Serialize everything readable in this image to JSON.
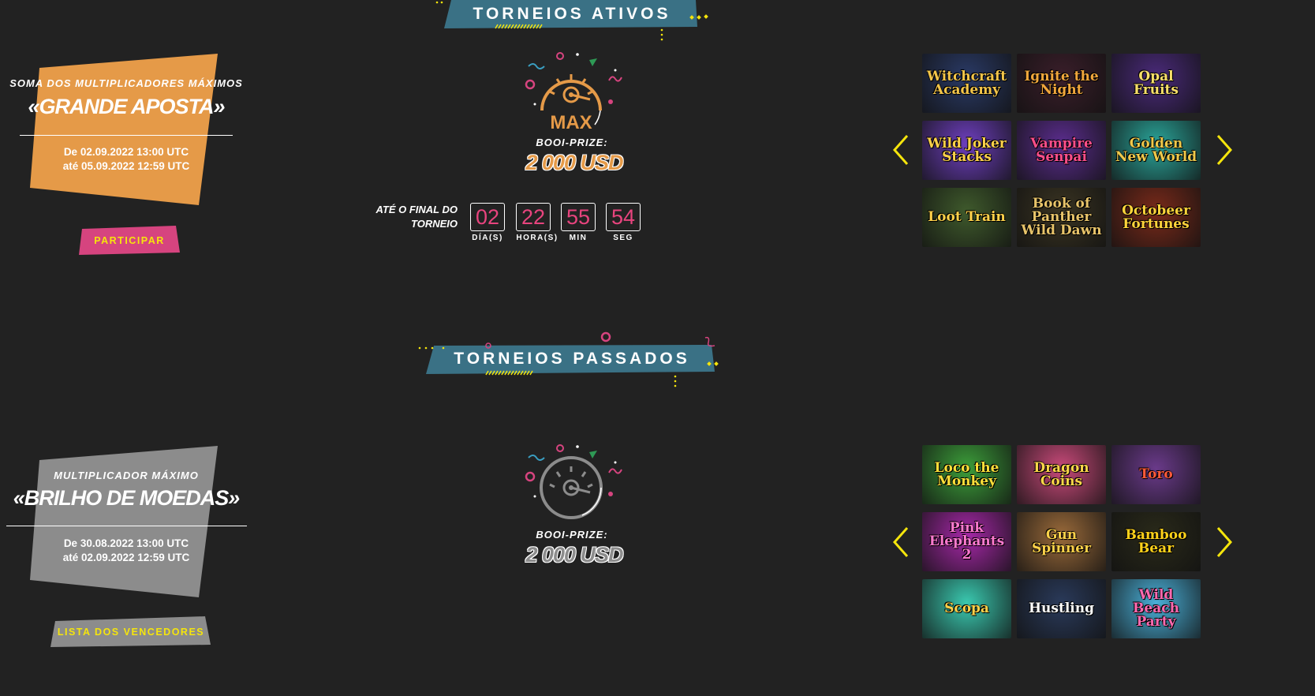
{
  "colors": {
    "background": "#222222",
    "banner": "#3a7185",
    "accent_yellow": "#f5e50c",
    "accent_pink": "#d6447f",
    "active_card": "#e59a48",
    "past_card": "#8c8c8c",
    "countdown_digits": "#e8447e",
    "arrow": "#f5e50c"
  },
  "active": {
    "heading": "TORNEIOS ATIVOS",
    "card": {
      "label": "SOMA DOS MULTIPLICADORES MÁXIMOS",
      "title": "«GRANDE APOSTA»",
      "dates_from": "De 02.09.2022 13:00 UTC",
      "dates_to": "até 05.09.2022 12:59 UTC",
      "button": "PARTICIPAR"
    },
    "gauge_text": "MAX",
    "prize_label": "BOOI-PRIZE:",
    "prize_value": "2 000 USD",
    "countdown": {
      "caption_line1": "ATÉ O FINAL DO",
      "caption_line2": "TORNEIO",
      "days": "02",
      "hours": "22",
      "minutes": "55",
      "seconds": "54",
      "days_label": "DÍA(S)",
      "hours_label": "HORA(S)",
      "minutes_label": "MIN",
      "seconds_label": "SEG"
    },
    "games": [
      {
        "name": "Witchcraft Academy",
        "bg": "#2a3a66",
        "fg": "#f4c64a",
        "icon": "witch-dragon"
      },
      {
        "name": "Ignite the Night",
        "bg": "#3a1e2a",
        "fg": "#f1a73c",
        "icon": "torch-dancer"
      },
      {
        "name": "Opal Fruits",
        "bg": "#4a2a7a",
        "fg": "#fbe06a",
        "icon": "fruits"
      },
      {
        "name": "Wild Joker Stacks",
        "bg": "#6e3fbf",
        "fg": "#ffd24a",
        "icon": "joker"
      },
      {
        "name": "Vampire Senpai",
        "bg": "#5b2d8e",
        "fg": "#ff4f8b",
        "icon": "vampire"
      },
      {
        "name": "Golden New World",
        "bg": "#2aa59a",
        "fg": "#f0c94b",
        "icon": "treasure-chest"
      },
      {
        "name": "Loot Train",
        "bg": "#3f5a2c",
        "fg": "#ffd24a",
        "icon": "cowgirl"
      },
      {
        "name": "Book of Panther Wild Dawn",
        "bg": "#3a3422",
        "fg": "#e8c46a",
        "icon": "panther"
      },
      {
        "name": "Octobeer Fortunes",
        "bg": "#7a2a1a",
        "fg": "#ffd43b",
        "icon": "beer-girl"
      }
    ]
  },
  "past": {
    "heading": "TORNEIOS PASSADOS",
    "card": {
      "label": "MULTIPLICADOR MÁXIMO",
      "title": "«BRILHO DE MOEDAS»",
      "dates_from": "De 30.08.2022 13:00 UTC",
      "dates_to": "até 02.09.2022 12:59 UTC",
      "button": "LISTA DOS VENCEDORES"
    },
    "prize_label": "BOOI-PRIZE:",
    "prize_value": "2 000 USD",
    "games": [
      {
        "name": "Loco the Monkey",
        "bg": "#3c9e3a",
        "fg": "#ffe03a",
        "icon": "monkey"
      },
      {
        "name": "Dragon Coins",
        "bg": "#c94a7a",
        "fg": "#ffd84a",
        "icon": "dragon"
      },
      {
        "name": "Toro",
        "bg": "#6a3a8a",
        "fg": "#ff5a3a",
        "icon": "bull"
      },
      {
        "name": "Pink Elephants 2",
        "bg": "#a628a8",
        "fg": "#ff7ad0",
        "icon": "elephant"
      },
      {
        "name": "Gun Spinner",
        "bg": "#9a6a3a",
        "fg": "#ffd24a",
        "icon": "cowboy"
      },
      {
        "name": "Bamboo Bear",
        "bg": "#2a2a1a",
        "fg": "#ffd21a",
        "icon": "panda"
      },
      {
        "name": "Scopa",
        "bg": "#3ac9b0",
        "fg": "#ffd24a",
        "icon": "cards"
      },
      {
        "name": "Hustling",
        "bg": "#2a3a5a",
        "fg": "#ffffff",
        "icon": "hustlers"
      },
      {
        "name": "Wild Beach Party",
        "bg": "#4ab0d8",
        "fg": "#ff6ab0",
        "icon": "beach-girl"
      }
    ]
  }
}
